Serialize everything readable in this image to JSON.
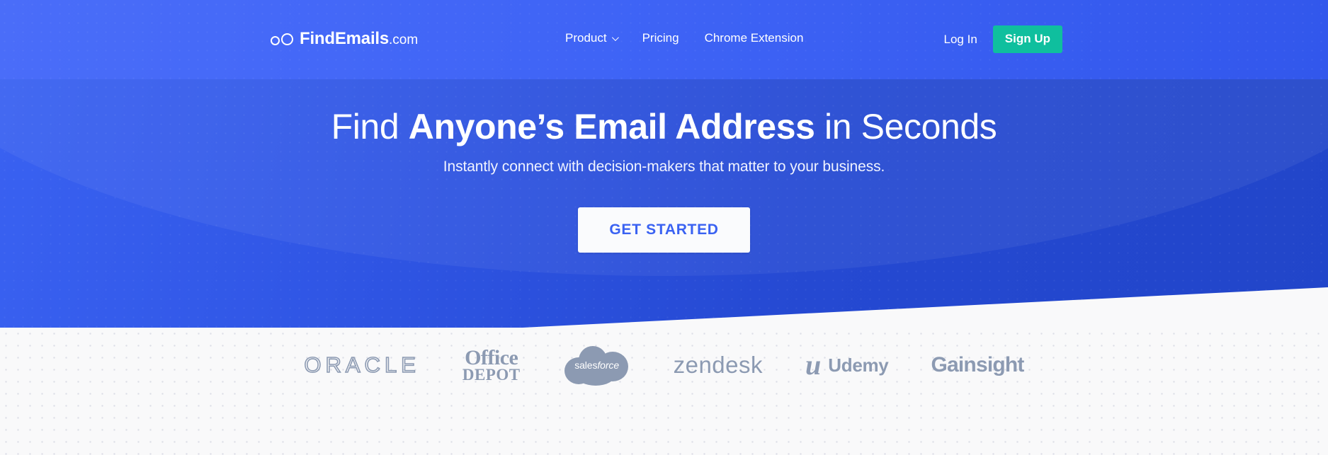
{
  "header": {
    "logo": {
      "mark": "two-circles-icon",
      "name": "FindEmails",
      "tld": ".com"
    },
    "nav": [
      {
        "label": "Product",
        "has_dropdown": true,
        "icon": "chevron-down-icon"
      },
      {
        "label": "Pricing",
        "has_dropdown": false
      },
      {
        "label": "Chrome Extension",
        "has_dropdown": false
      }
    ],
    "auth": {
      "login_label": "Log In",
      "signup_label": "Sign Up"
    }
  },
  "hero": {
    "headline_pre": "Find ",
    "headline_em": "Anyone’s Email Address",
    "headline_post": " in Seconds",
    "subhead": "Instantly connect with decision-makers that matter to your business.",
    "cta_label": "GET STARTED"
  },
  "clients": [
    {
      "name": "Oracle",
      "text": "ORACLE"
    },
    {
      "name": "Office Depot",
      "line1": "Office",
      "line2": "DEPOT"
    },
    {
      "name": "Salesforce",
      "text_a": "sales",
      "text_b": "force"
    },
    {
      "name": "Zendesk",
      "text": "zendesk"
    },
    {
      "name": "Udemy",
      "mark": "u",
      "text": "Udemy"
    },
    {
      "name": "Gainsight",
      "text": "Gainsight"
    }
  ],
  "colors": {
    "header_blue": "#4068f8",
    "hero_blue_left": "#3a62f2",
    "hero_blue_right": "#2145c9",
    "signup_green": "#0fbf9e",
    "cta_text_blue": "#3a62f2",
    "client_gray": "#8c9ab2",
    "strip_bg": "#f9f9fa"
  }
}
